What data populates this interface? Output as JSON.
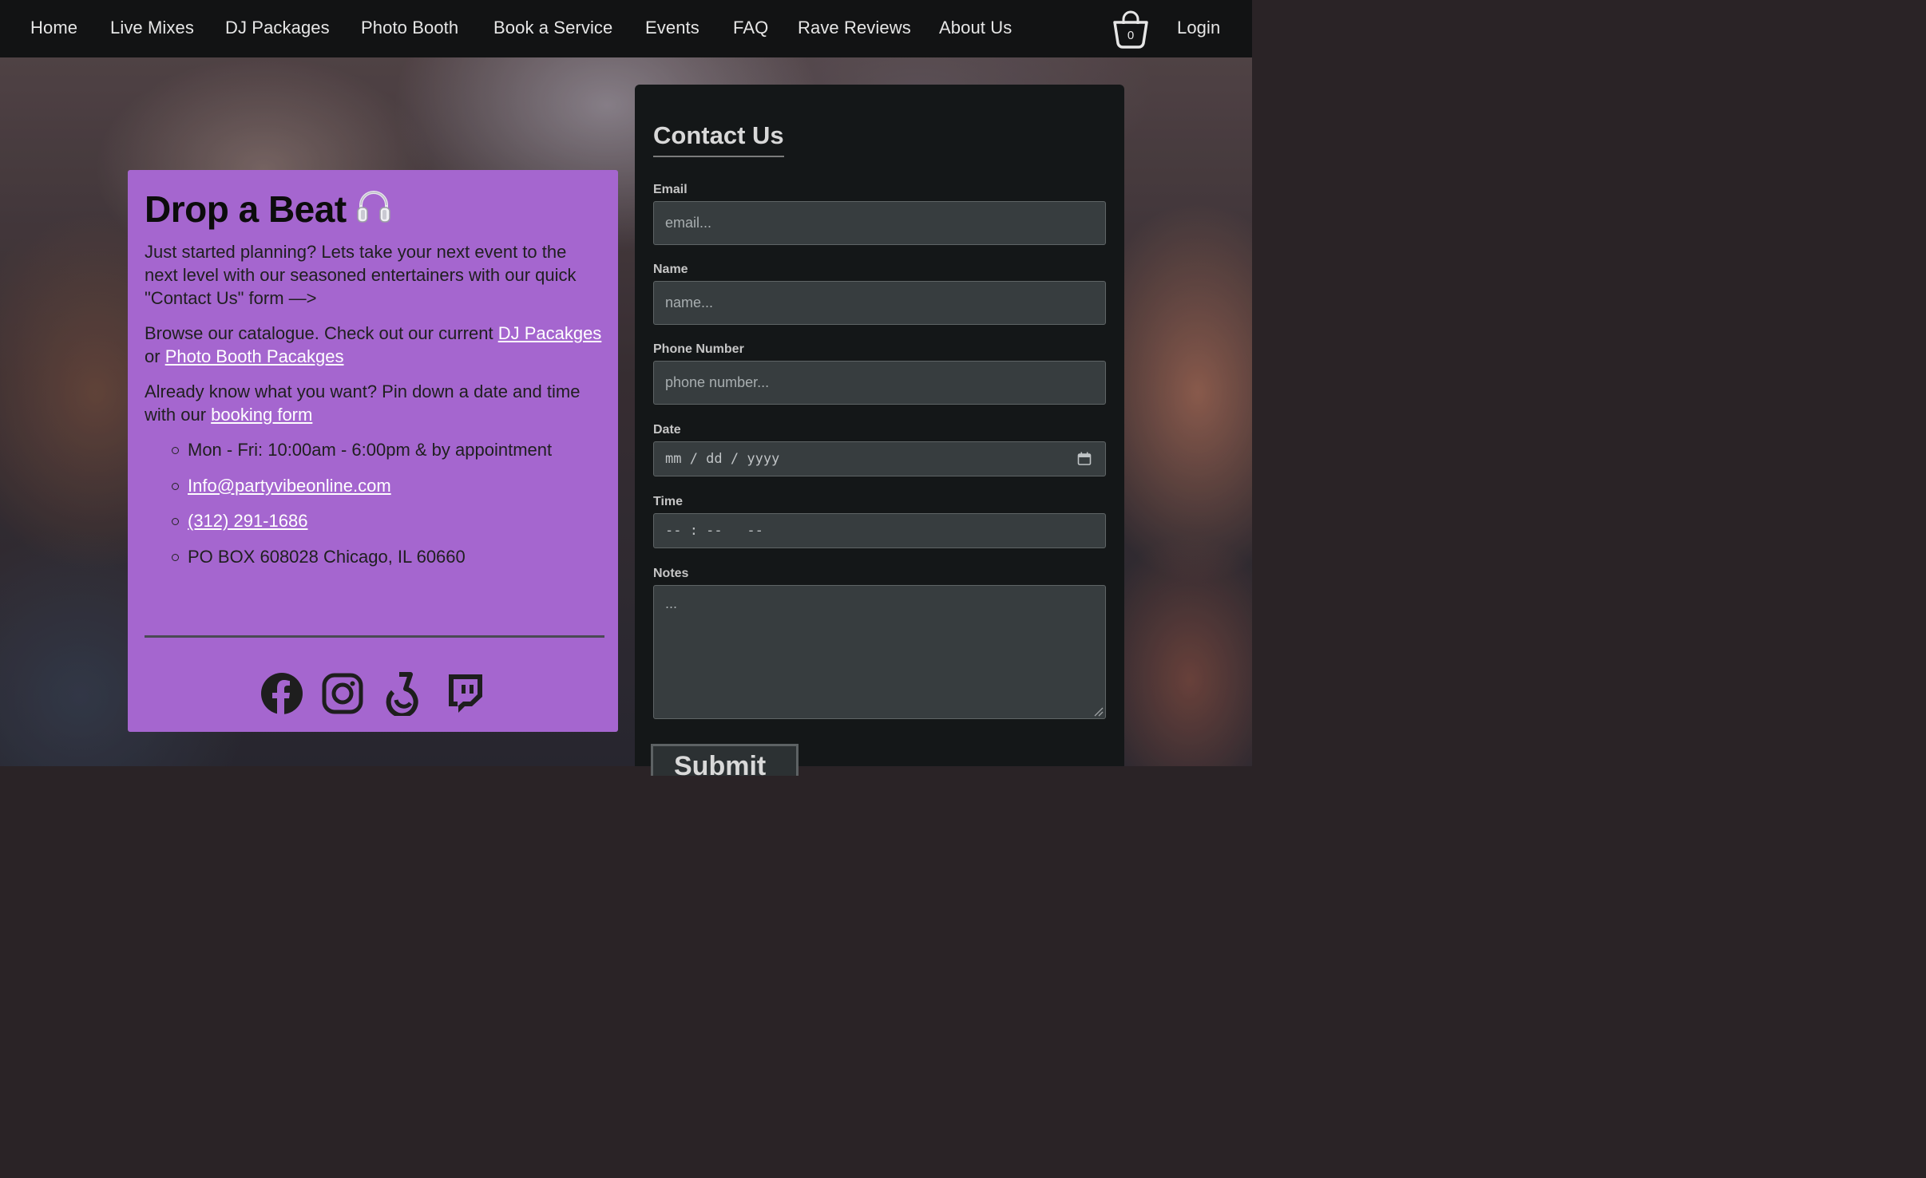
{
  "nav": {
    "items": [
      {
        "label": "Home"
      },
      {
        "label": "Live Mixes"
      },
      {
        "label": "DJ Packages"
      },
      {
        "label": "Photo Booth"
      },
      {
        "label": "Book a Service"
      },
      {
        "label": "Events"
      },
      {
        "label": "FAQ"
      },
      {
        "label": "Rave Reviews"
      },
      {
        "label": "About Us"
      }
    ],
    "cart_count": "0",
    "cart_icon": "shopping-basket-icon",
    "login_label": "Login"
  },
  "info": {
    "title": "Drop a Beat",
    "title_icon": "headphones-icon",
    "intro": "Just started planning? Lets take your next event to the next level with our seasoned entertainers with our quick \"Contact Us\" form —>",
    "browse_prefix": "Browse our catalogue. Check out our current ",
    "browse_link1": "DJ Pacakges",
    "browse_or": " or ",
    "browse_link2": "Photo Booth Pacakges",
    "booking_prefix": "Already know what you want? Pin down a date and time with our ",
    "booking_link": "booking form",
    "contacts": {
      "hours": "Mon - Fri: 10:00am - 6:00pm & by appointment",
      "email": "Info@partyvibeonline.com",
      "phone": "(312) 291-1686",
      "address": "PO BOX 608028 Chicago, IL 60660"
    },
    "socials": [
      "facebook-icon",
      "instagram-icon",
      "bandlab-icon",
      "twitch-icon"
    ]
  },
  "form": {
    "title": "Contact Us",
    "email_label": "Email",
    "email_placeholder": "email...",
    "name_label": "Name",
    "name_placeholder": "name...",
    "phone_label": "Phone Number",
    "phone_placeholder": "phone number...",
    "date_label": "Date",
    "date_placeholder": "mm / dd / yyyy",
    "time_label": "Time",
    "time_placeholder": "-- : --   --",
    "notes_label": "Notes",
    "notes_placeholder": "...",
    "submit_label": "Submit"
  },
  "colors": {
    "nav_bg": "#121314",
    "card_purple": "#a566cf",
    "form_bg": "#141718",
    "field_bg": "#373d3f"
  }
}
